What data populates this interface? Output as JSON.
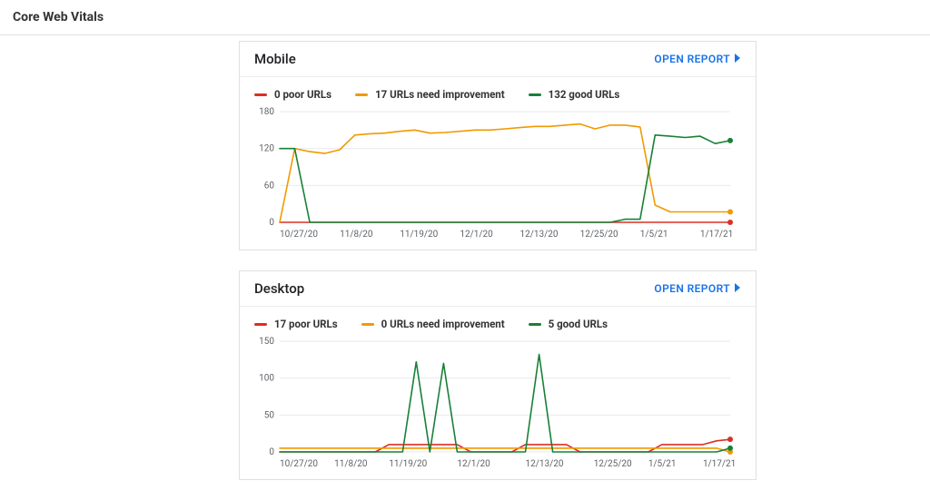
{
  "page": {
    "title": "Core Web Vitals"
  },
  "open_report_label": "OPEN REPORT",
  "colors": {
    "poor": "#d93025",
    "need": "#f29900",
    "good": "#188038",
    "grid": "#eaeaea",
    "tick": "#5f6368"
  },
  "cards": [
    {
      "id": "mobile",
      "title": "Mobile",
      "legend": [
        {
          "key": "poor",
          "label": "0 poor URLs",
          "color": "#d93025"
        },
        {
          "key": "need",
          "label": "17 URLs need improvement",
          "color": "#f29900"
        },
        {
          "key": "good",
          "label": "132 good URLs",
          "color": "#188038"
        }
      ]
    },
    {
      "id": "desktop",
      "title": "Desktop",
      "legend": [
        {
          "key": "poor",
          "label": "17 poor URLs",
          "color": "#d93025"
        },
        {
          "key": "need",
          "label": "0 URLs need improvement",
          "color": "#f29900"
        },
        {
          "key": "good",
          "label": "5 good URLs",
          "color": "#188038"
        }
      ]
    }
  ],
  "chart_data": [
    {
      "card": "mobile",
      "type": "line",
      "ylim": [
        0,
        180
      ],
      "yticks": [
        0,
        60,
        120,
        180
      ],
      "x": [
        "10/27/20",
        "10/30/20",
        "11/2/20",
        "11/5/20",
        "11/8/20",
        "11/11/20",
        "11/14/20",
        "11/17/20",
        "11/19/20",
        "11/22/20",
        "11/25/20",
        "11/28/20",
        "12/1/20",
        "12/4/20",
        "12/7/20",
        "12/10/20",
        "12/13/20",
        "12/16/20",
        "12/19/20",
        "12/22/20",
        "12/25/20",
        "12/28/20",
        "12/31/20",
        "1/2/21",
        "1/5/21",
        "1/8/21",
        "1/11/21",
        "1/14/21",
        "1/17/21",
        "1/20/21",
        "1/23/21"
      ],
      "xticks": [
        "10/27/20",
        "11/8/20",
        "11/19/20",
        "12/1/20",
        "12/13/20",
        "12/25/20",
        "1/5/21",
        "1/17/21"
      ],
      "series": [
        {
          "name": "poor",
          "color": "#d93025",
          "values": [
            0,
            0,
            0,
            0,
            0,
            0,
            0,
            0,
            0,
            0,
            0,
            0,
            0,
            0,
            0,
            0,
            0,
            0,
            0,
            0,
            0,
            0,
            0,
            0,
            0,
            0,
            0,
            0,
            0,
            0,
            0
          ]
        },
        {
          "name": "need",
          "color": "#f29900",
          "values": [
            0,
            120,
            115,
            112,
            118,
            142,
            144,
            145,
            148,
            150,
            145,
            146,
            148,
            150,
            150,
            152,
            154,
            156,
            156,
            158,
            160,
            152,
            158,
            158,
            155,
            28,
            17,
            17,
            17,
            17,
            17
          ]
        },
        {
          "name": "good",
          "color": "#188038",
          "values": [
            120,
            120,
            0,
            0,
            0,
            0,
            0,
            0,
            0,
            0,
            0,
            0,
            0,
            0,
            0,
            0,
            0,
            0,
            0,
            0,
            0,
            0,
            0,
            5,
            5,
            142,
            140,
            138,
            140,
            128,
            133
          ]
        }
      ],
      "end_markers": {
        "poor": 0,
        "need": 17,
        "good": 133
      }
    },
    {
      "card": "desktop",
      "type": "line",
      "ylim": [
        0,
        150
      ],
      "yticks": [
        0,
        50,
        100,
        150
      ],
      "x": [
        "10/27/20",
        "10/30/20",
        "11/2/20",
        "11/5/20",
        "11/8/20",
        "11/11/20",
        "11/14/20",
        "11/17/20",
        "11/19/20",
        "11/22/20",
        "11/25/20",
        "11/27/20",
        "11/29/20",
        "12/1/20",
        "12/3/20",
        "12/5/20",
        "12/8/20",
        "12/11/20",
        "12/13/20",
        "12/15/20",
        "12/17/20",
        "12/19/20",
        "12/21/20",
        "12/25/20",
        "12/28/20",
        "12/31/20",
        "1/2/21",
        "1/5/21",
        "1/8/21",
        "1/11/21",
        "1/14/21",
        "1/17/21",
        "1/20/21",
        "1/23/21"
      ],
      "xticks": [
        "10/27/20",
        "11/8/20",
        "11/19/20",
        "12/1/20",
        "12/13/20",
        "12/25/20",
        "1/5/21",
        "1/17/21"
      ],
      "series": [
        {
          "name": "poor",
          "color": "#d93025",
          "values": [
            0,
            0,
            0,
            0,
            0,
            0,
            0,
            0,
            10,
            10,
            10,
            10,
            10,
            10,
            0,
            0,
            0,
            0,
            10,
            10,
            10,
            10,
            0,
            0,
            0,
            0,
            0,
            0,
            10,
            10,
            10,
            10,
            15,
            17
          ]
        },
        {
          "name": "need",
          "color": "#f29900",
          "values": [
            5,
            5,
            5,
            5,
            5,
            5,
            5,
            5,
            5,
            5,
            5,
            5,
            5,
            5,
            5,
            5,
            5,
            5,
            5,
            5,
            5,
            5,
            5,
            5,
            5,
            5,
            5,
            5,
            5,
            5,
            5,
            5,
            5,
            0
          ]
        },
        {
          "name": "good",
          "color": "#188038",
          "values": [
            0,
            0,
            0,
            0,
            0,
            0,
            0,
            0,
            0,
            0,
            122,
            0,
            120,
            0,
            0,
            0,
            0,
            0,
            0,
            132,
            0,
            0,
            0,
            0,
            0,
            0,
            0,
            0,
            0,
            0,
            0,
            0,
            0,
            5
          ]
        }
      ],
      "end_markers": {
        "poor": 17,
        "need": 0,
        "good": 5
      }
    }
  ]
}
